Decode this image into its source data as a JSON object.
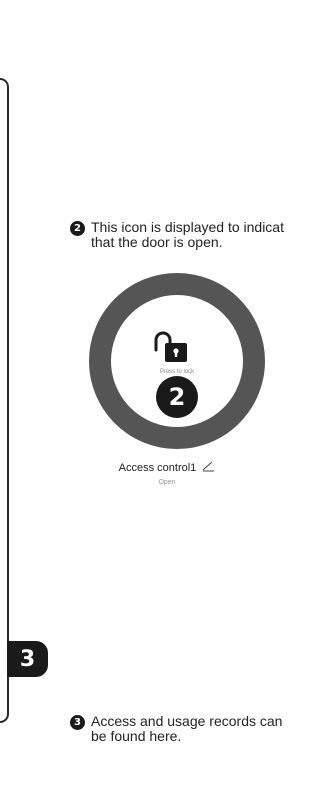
{
  "callout_door_open": {
    "number": "2",
    "line1": "This icon is displayed to indicat",
    "line2": "that the door is open."
  },
  "lock_ring": {
    "press_label": "Press to lock",
    "step_number": "2"
  },
  "device": {
    "name": "Access control1",
    "status": "Open"
  },
  "step_marker": {
    "number": "3"
  },
  "callout_records": {
    "number": "3",
    "line1": "Access and usage records can",
    "line2": "be found here."
  },
  "colors": {
    "ring": "#555555",
    "badge": "#1a1a1a",
    "accent_arc": "#ffffff"
  }
}
